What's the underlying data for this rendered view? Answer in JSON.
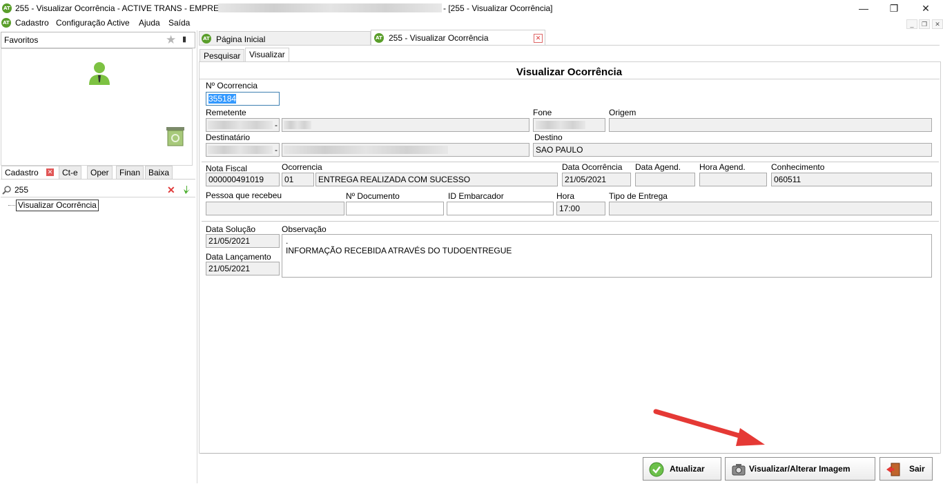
{
  "window": {
    "title_prefix": "255 - Visualizar Ocorrência - ACTIVE TRANS - EMPRESA:",
    "title_suffix": "- [255 - Visualizar Ocorrência]",
    "minimize": "—",
    "restore": "❐",
    "close": "✕",
    "logo_text": "AT"
  },
  "menu": {
    "items": [
      "Cadastro",
      "Configuração Active",
      "Ajuda",
      "Saída"
    ],
    "mdi_minimize": "_",
    "mdi_restore": "❐",
    "mdi_close": "✕"
  },
  "sidebar": {
    "favorites_label": "Favoritos",
    "tabs": [
      "Cadastro",
      "Ct-e",
      "Oper",
      "Finan",
      "Baixa"
    ],
    "search_value": "255",
    "tree_item": "Visualizar Ocorrência"
  },
  "doc_tabs": {
    "home": "Página Inicial",
    "active": "255 - Visualizar Ocorrência"
  },
  "sub_tabs": [
    "Pesquisar",
    "Visualizar"
  ],
  "form": {
    "title": "Visualizar Ocorrência",
    "n_ocorrencia_label": "Nº Ocorrencia",
    "n_ocorrencia_value": "355184",
    "remetente_label": "Remetente",
    "remetente_dash": "-",
    "fone_label": "Fone",
    "origem_label": "Origem",
    "destinatario_label": "Destinatário",
    "destinatario_dash": "-",
    "destino_label": "Destino",
    "destino_value": "SAO PAULO",
    "nota_fiscal_label": "Nota Fiscal",
    "nota_fiscal_value": "000000491019",
    "ocorrencia_label": "Ocorrencia",
    "ocorrencia_code": "01",
    "ocorrencia_desc": "ENTREGA REALIZADA COM SUCESSO",
    "data_ocorrencia_label": "Data Ocorrência",
    "data_ocorrencia_value": "21/05/2021",
    "data_agend_label": "Data Agend.",
    "hora_agend_label": "Hora Agend.",
    "conhecimento_label": "Conhecimento",
    "conhecimento_value": "060511",
    "pessoa_label": "Pessoa que recebeu",
    "n_documento_label": "Nº Documento",
    "id_embarcador_label": "ID Embarcador",
    "hora_label": "Hora",
    "hora_value": "17:00",
    "tipo_entrega_label": "Tipo de Entrega",
    "data_solucao_label": "Data Solução",
    "data_solucao_value": "21/05/2021",
    "data_lancamento_label": "Data Lançamento",
    "data_lancamento_value": "21/05/2021",
    "observacao_label": "Observação",
    "observacao_line1": ".",
    "observacao_line2": "INFORMAÇÃO RECEBIDA ATRAVÉS DO TUDOENTREGUE"
  },
  "buttons": {
    "atualizar": "Atualizar",
    "imagem": "Visualizar/Alterar Imagem",
    "sair": "Sair"
  },
  "colors": {
    "brand_green": "#5a9e2b",
    "selection_blue": "#3399ff",
    "arrow_red": "#e53935"
  }
}
